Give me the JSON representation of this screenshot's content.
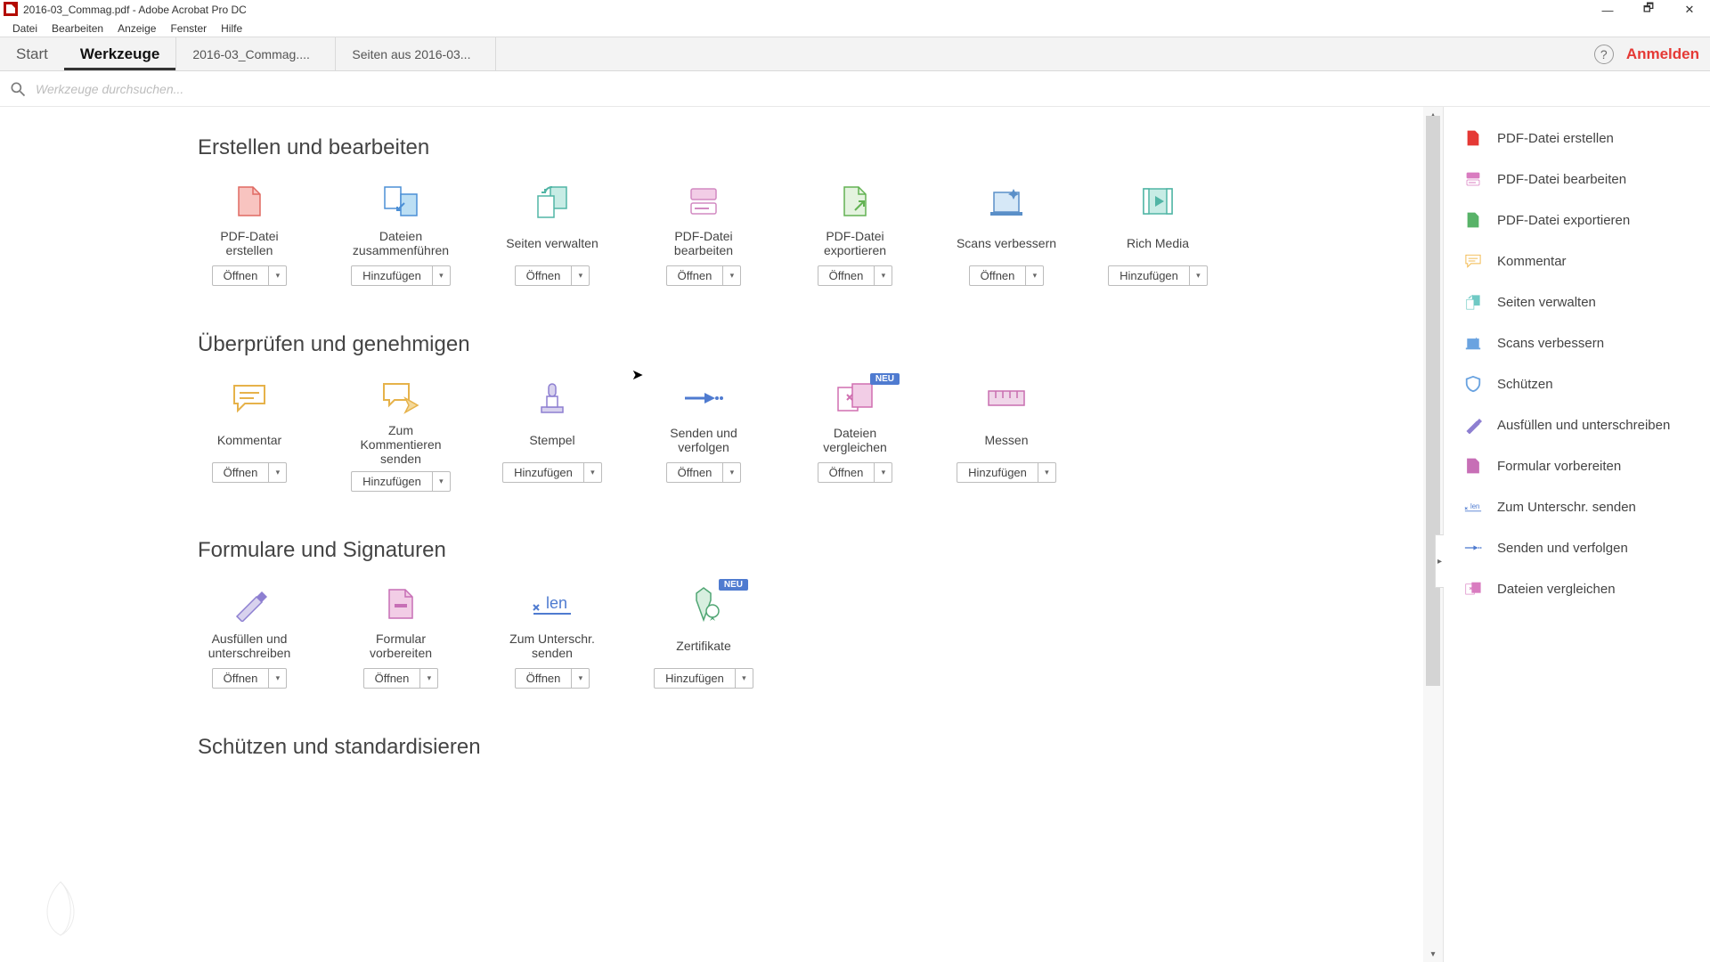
{
  "window": {
    "title": "2016-03_Commag.pdf - Adobe Acrobat Pro DC",
    "minimize": "—",
    "maximize": "🗗",
    "close": "✕"
  },
  "menu": {
    "items": [
      "Datei",
      "Bearbeiten",
      "Anzeige",
      "Fenster",
      "Hilfe"
    ]
  },
  "tabs": {
    "start": "Start",
    "tools": "Werkzeuge",
    "doc1": "2016-03_Commag....",
    "doc2": "Seiten aus 2016-03...",
    "help_glyph": "?",
    "signin": "Anmelden"
  },
  "search": {
    "placeholder": "Werkzeuge durchsuchen..."
  },
  "labels": {
    "open": "Öffnen",
    "add": "Hinzufügen",
    "neu": "NEU"
  },
  "sections": {
    "s1": {
      "title": "Erstellen und bearbeiten",
      "tools": [
        {
          "id": "create-pdf",
          "label": "PDF-Datei erstellen",
          "action": "open",
          "icon": "create-pdf-icon"
        },
        {
          "id": "combine",
          "label": "Dateien zusammenführen",
          "action": "add",
          "icon": "combine-icon"
        },
        {
          "id": "organize",
          "label": "Seiten verwalten",
          "action": "open",
          "icon": "organize-icon"
        },
        {
          "id": "edit-pdf",
          "label": "PDF-Datei bearbeiten",
          "action": "open",
          "icon": "edit-pdf-icon"
        },
        {
          "id": "export-pdf",
          "label": "PDF-Datei exportieren",
          "action": "open",
          "icon": "export-pdf-icon"
        },
        {
          "id": "enhance-scans",
          "label": "Scans verbessern",
          "action": "open",
          "icon": "scan-enhance-icon"
        },
        {
          "id": "rich-media",
          "label": "Rich Media",
          "action": "add",
          "icon": "rich-media-icon"
        }
      ]
    },
    "s2": {
      "title": "Überprüfen und genehmigen",
      "tools": [
        {
          "id": "comment",
          "label": "Kommentar",
          "action": "open",
          "icon": "comment-icon"
        },
        {
          "id": "send-comments",
          "label": "Zum Kommentieren senden",
          "action": "add",
          "icon": "send-comments-icon"
        },
        {
          "id": "stamp",
          "label": "Stempel",
          "action": "add",
          "icon": "stamp-icon"
        },
        {
          "id": "send-track",
          "label": "Senden und verfolgen",
          "action": "open",
          "icon": "send-track-icon"
        },
        {
          "id": "compare",
          "label": "Dateien vergleichen",
          "action": "open",
          "icon": "compare-icon",
          "neu": true
        },
        {
          "id": "measure",
          "label": "Messen",
          "action": "add",
          "icon": "measure-icon"
        }
      ]
    },
    "s3": {
      "title": "Formulare und Signaturen",
      "tools": [
        {
          "id": "fill-sign",
          "label": "Ausfüllen und unterschreiben",
          "action": "open",
          "icon": "fill-sign-icon"
        },
        {
          "id": "prepare-form",
          "label": "Formular vorbereiten",
          "action": "open",
          "icon": "prepare-form-icon"
        },
        {
          "id": "send-sign",
          "label": "Zum Unterschr. senden",
          "action": "open",
          "icon": "send-sign-icon"
        },
        {
          "id": "certificates",
          "label": "Zertifikate",
          "action": "add",
          "icon": "certificates-icon",
          "neu": true
        }
      ]
    },
    "s4": {
      "title": "Schützen und standardisieren",
      "tools": []
    }
  },
  "right_panel": {
    "items": [
      {
        "id": "rp-create",
        "label": "PDF-Datei erstellen",
        "icon": "create-pdf-icon",
        "color": "#e53935"
      },
      {
        "id": "rp-edit",
        "label": "PDF-Datei bearbeiten",
        "icon": "edit-pdf-icon",
        "color": "#d97cc0"
      },
      {
        "id": "rp-export",
        "label": "PDF-Datei exportieren",
        "icon": "export-pdf-icon",
        "color": "#58b368"
      },
      {
        "id": "rp-comment",
        "label": "Kommentar",
        "icon": "comment-icon",
        "color": "#f2b84b"
      },
      {
        "id": "rp-organize",
        "label": "Seiten verwalten",
        "icon": "organize-icon",
        "color": "#6fc9c4"
      },
      {
        "id": "rp-enhance",
        "label": "Scans verbessern",
        "icon": "scan-enhance-icon",
        "color": "#6aa3e0"
      },
      {
        "id": "rp-protect",
        "label": "Schützen",
        "icon": "protect-icon",
        "color": "#6aa3e0"
      },
      {
        "id": "rp-fillsign",
        "label": "Ausfüllen und unterschreiben",
        "icon": "fill-sign-icon",
        "color": "#8d7fd1"
      },
      {
        "id": "rp-prepform",
        "label": "Formular vorbereiten",
        "icon": "prepare-form-icon",
        "color": "#c76fb6"
      },
      {
        "id": "rp-sendsign",
        "label": "Zum Unterschr. senden",
        "icon": "send-sign-icon",
        "color": "#4f7bd0"
      },
      {
        "id": "rp-sendtrk",
        "label": "Senden und verfolgen",
        "icon": "send-track-icon",
        "color": "#4f7bd0"
      },
      {
        "id": "rp-compare",
        "label": "Dateien vergleichen",
        "icon": "compare-icon",
        "color": "#d97cc0"
      }
    ]
  }
}
